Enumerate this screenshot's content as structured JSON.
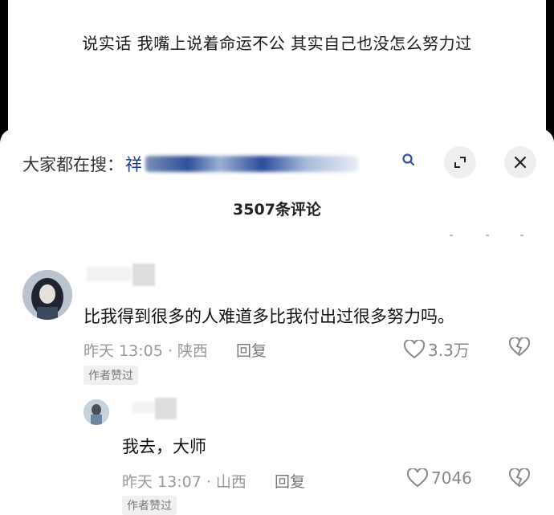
{
  "post": {
    "text": "说实话 我嘴上说着命运不公 其实自己也没怎么努力过"
  },
  "sheet": {
    "search_prefix": "大家都在搜：",
    "search_query": "祥",
    "count_label": "3507条评论"
  },
  "comments": [
    {
      "text": "比我得到很多的人难道多比我付出过很多努力吗。",
      "meta": "昨天 13:05 · 陕西",
      "reply_label": "回复",
      "likes": "3.3万",
      "badge": "作者赞过"
    },
    {
      "text": "我去，大师",
      "meta": "昨天 13:07 · 山西",
      "reply_label": "回复",
      "likes": "7046",
      "badge": "作者赞过"
    }
  ]
}
